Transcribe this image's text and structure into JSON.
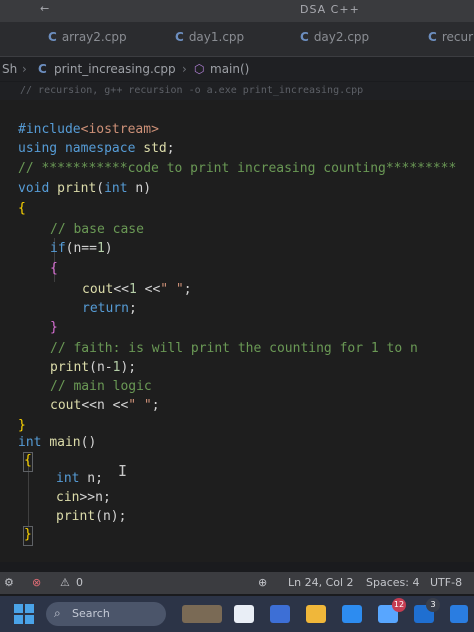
{
  "window": {
    "title": "DSA C++"
  },
  "tabs": [
    {
      "label": "array2.cpp",
      "icon": "cpp-file-icon"
    },
    {
      "label": "day1.cpp",
      "icon": "cpp-file-icon"
    },
    {
      "label": "day2.cpp",
      "icon": "cpp-file-icon"
    },
    {
      "label": "recur",
      "icon": "cpp-file-icon"
    }
  ],
  "breadcrumb": {
    "prefix": "Sh",
    "file": "print_increasing.cpp",
    "symbol": "main()"
  },
  "infoline": "// recursion, g++ recursion -o a.exe print_increasing.cpp",
  "code_lines": [
    "#include<iostream>",
    "using namespace std;",
    "// ***********code to print increasing counting*********",
    "void print(int n)",
    "{",
    "    // base case",
    "    if(n==1)",
    "    {",
    "        cout<<1 <<\" \";",
    "        return;",
    "    }",
    "    // faith: is will print the counting for 1 to n",
    "    print(n-1);",
    "    // main logic",
    "    cout<<n <<\" \";",
    "}",
    "int main()",
    "{",
    "    int n;",
    "    cin>>n;",
    "    print(n);",
    "}"
  ],
  "status": {
    "problems": "0",
    "cursor_position": "Ln 24, Col 2",
    "spaces": "Spaces: 4",
    "encoding": "UTF-8"
  },
  "taskbar": {
    "search_placeholder": "Search",
    "badge_count": "12",
    "badge_count_2": "3"
  },
  "colors": {
    "editor_bg": "#1e1e1e",
    "keyword": "#569cd6",
    "comment": "#6a9955",
    "function": "#dcdcaa",
    "string": "#ce9178",
    "bracket": "#ffd700"
  }
}
